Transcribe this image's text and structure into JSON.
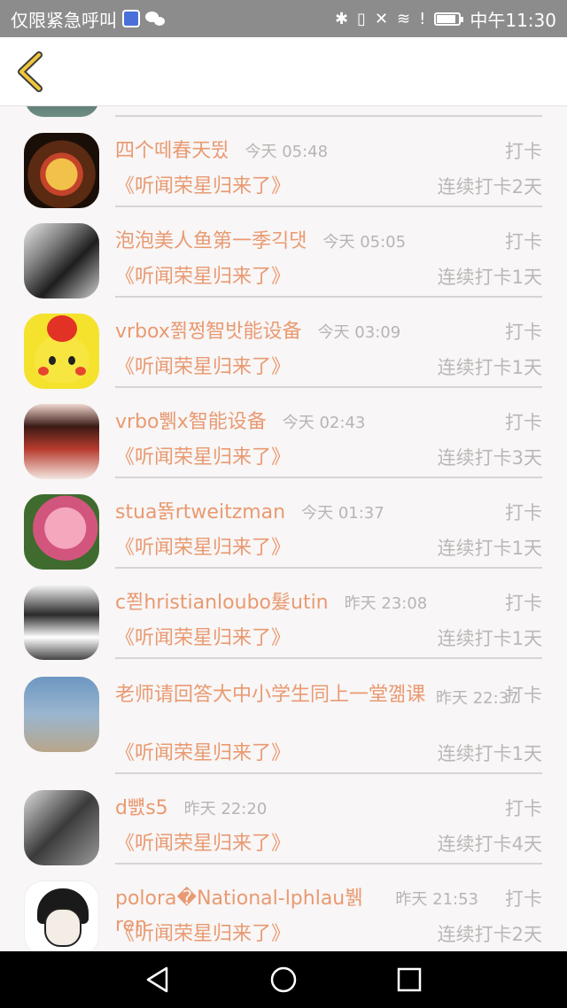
{
  "status_bar": {
    "left_text": "仅限紧急呼叫",
    "time": "中午11:30",
    "battery_level": 0.85,
    "icons": [
      "music-app-icon",
      "wechat-icon",
      "bluetooth-icon",
      "vibrate-icon",
      "mute-icon",
      "wifi-icon",
      "sim-alert-icon",
      "battery-icon"
    ]
  },
  "header": {
    "back_icon": "chevron-left-icon"
  },
  "list": {
    "items": [
      {
        "name": "四个떼春天뜄",
        "time": "今天 05:48",
        "action": "打卡",
        "book": "《听闻荣星归来了》",
        "streak": "连续打卡2天"
      },
      {
        "name": "泡泡美人鱼第一季긱댓",
        "time": "今天 05:05",
        "action": "打卡",
        "book": "《听闻荣星归来了》",
        "streak": "连续打卡1天"
      },
      {
        "name": "vrbox쬙쩡智밧能设备",
        "time": "今天 03:09",
        "action": "打卡",
        "book": "《听闻荣星归来了》",
        "streak": "连续打卡1天"
      },
      {
        "name": "vrbo쀍x智能设备",
        "time": "今天 02:43",
        "action": "打卡",
        "book": "《听闻荣星归来了》",
        "streak": "连续打卡3天"
      },
      {
        "name": "stua뚉rtweitzman",
        "time": "今天 01:37",
        "action": "打卡",
        "book": "《听闻荣星归来了》",
        "streak": "连续打卡1天"
      },
      {
        "name": "c쬗hristianloubo髮utin",
        "time": "昨天 23:08",
        "action": "打卡",
        "book": "《听闻荣星归来了》",
        "streak": "连续打卡1天"
      },
      {
        "name": "老师请回答大中小学生同上一堂꼚课",
        "time": "昨天 22:37",
        "action": "打卡",
        "book": "《听闻荣星归来了》",
        "streak": "连续打卡1天"
      },
      {
        "name": "d뻀s5",
        "time": "昨天 22:20",
        "action": "打卡",
        "book": "《听闻荣星归来了》",
        "streak": "连续打卡4天"
      },
      {
        "name": "polora�National-lphlau뷁ren",
        "time": "昨天 21:53",
        "action": "打卡",
        "book": "《听闻荣星归来了》",
        "streak": "连续打卡2天"
      }
    ]
  },
  "nav_bar": {
    "icons": [
      "back-triangle-icon",
      "home-circle-icon",
      "recents-square-icon"
    ]
  }
}
